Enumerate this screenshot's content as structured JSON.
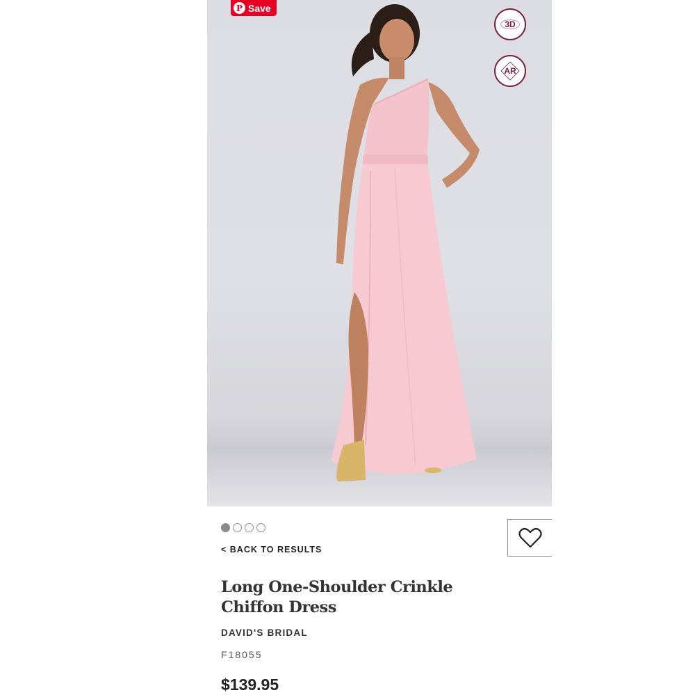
{
  "pinterest": {
    "save_label": "Save",
    "icon": "pinterest-icon",
    "color": "#e60023"
  },
  "viewer": {
    "btn_3d_label": "3D",
    "btn_ar_label": "AR",
    "accent": "#7a2140"
  },
  "carousel": {
    "total": 4,
    "active_index": 0
  },
  "nav": {
    "back_label": "< BACK TO RESULTS"
  },
  "product": {
    "title": "Long One-Shoulder Crinkle Chiffon Dress",
    "brand": "DAVID'S BRIDAL",
    "sku": "F18055",
    "price": "$139.95",
    "dress_color": "#f6c9cf"
  },
  "wishlist": {
    "icon": "heart-icon"
  }
}
